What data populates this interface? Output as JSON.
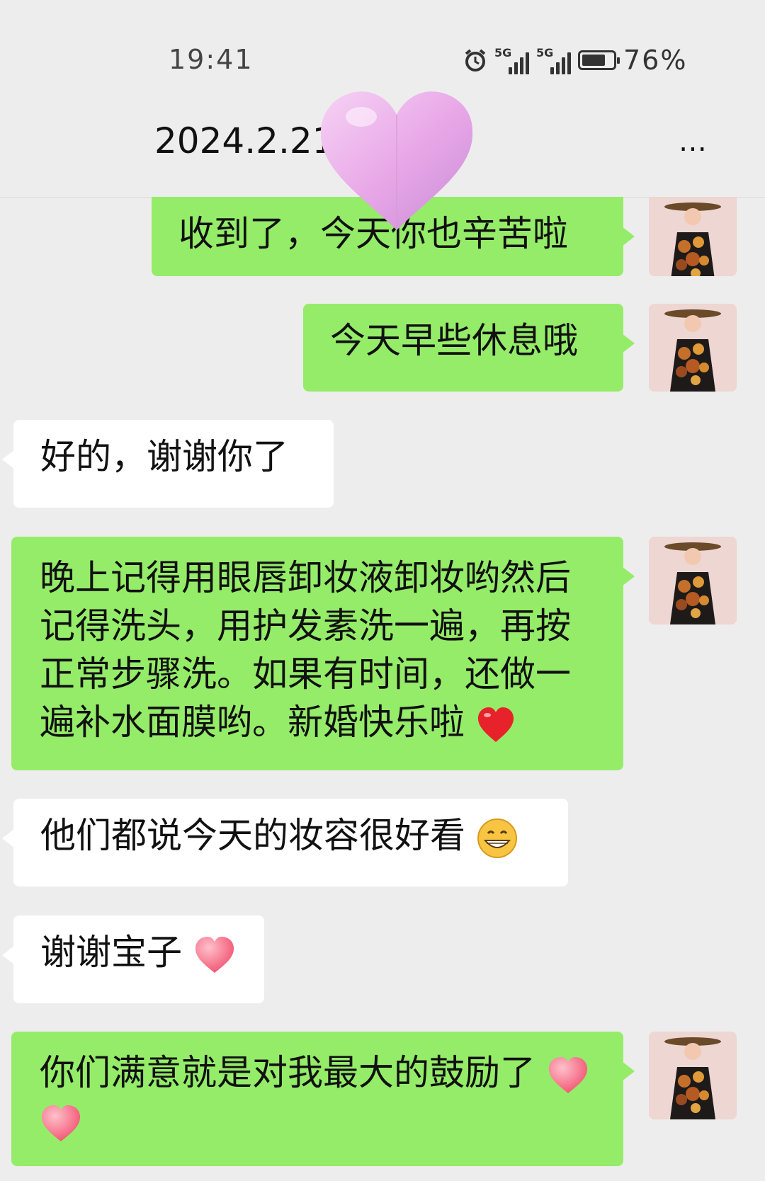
{
  "status_bar": {
    "time": "19:41",
    "signal1_label": "5G",
    "signal2_label": "5G",
    "battery_percent_text": "76%",
    "battery_level": 0.76
  },
  "header": {
    "title": "2024.2.21",
    "more_label": "⋯"
  },
  "messages": [
    {
      "side": "right",
      "text": "收到了，今天你也辛苦啦"
    },
    {
      "side": "right",
      "text": "今天早些休息哦"
    },
    {
      "side": "left",
      "text": "好的，谢谢你了"
    },
    {
      "side": "right",
      "text": "晚上记得用眼唇卸妆液卸妆哟然后记得洗头，用护发素洗一遍，再按正常步骤洗。如果有时间，还做一遍补水面膜哟。新婚快乐啦",
      "emoji": "red-heart"
    },
    {
      "side": "left",
      "text": "他们都说今天的妆容很好看",
      "emoji": "grin"
    },
    {
      "side": "left",
      "text": "谢谢宝子",
      "emoji": "pink-heart"
    },
    {
      "side": "right",
      "text": "你们满意就是对我最大的鼓励了",
      "emoji": "pink-heart-double"
    }
  ],
  "colors": {
    "background": "#ededed",
    "bubble_sent": "#95ec69",
    "bubble_received": "#ffffff"
  }
}
